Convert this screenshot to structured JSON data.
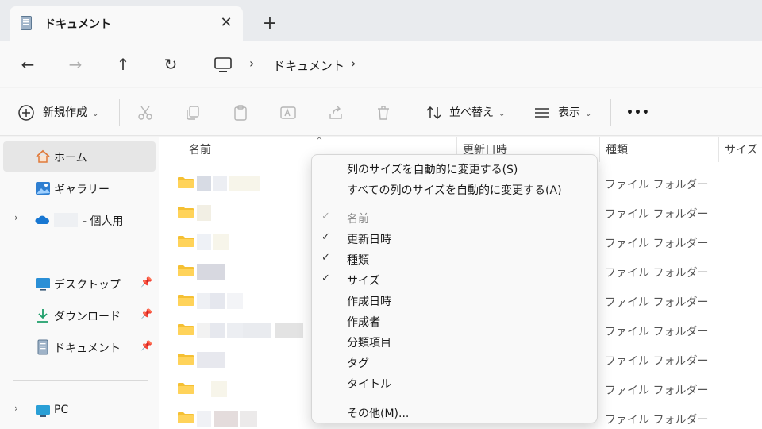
{
  "window": {
    "tab_title": "ドキュメント",
    "close_glyph": "✕",
    "new_tab_glyph": "+"
  },
  "nav": {
    "back_glyph": "←",
    "forward_glyph": "→",
    "up_glyph": "↑",
    "refresh_glyph": "↻",
    "sep_glyph": "›",
    "breadcrumb": [
      "ドキュメント"
    ]
  },
  "toolbar": {
    "new_label": "新規作成",
    "sort_label": "並べ替え",
    "view_label": "表示",
    "more_glyph": "•••",
    "chevron": "⌄"
  },
  "sidebar": {
    "home": "ホーム",
    "gallery": "ギャラリー",
    "onedrive": "- 個人用",
    "desktop": "デスクトップ",
    "downloads": "ダウンロード",
    "documents": "ドキュメント",
    "pc": "PC",
    "pin_glyph": "📌",
    "expand_glyph": "›"
  },
  "columns": {
    "name": "名前",
    "modified": "更新日時",
    "type": "種類",
    "size": "サイズ",
    "sort_glyph": "^"
  },
  "rows": [
    {
      "type": "ファイル フォルダー"
    },
    {
      "type": "ファイル フォルダー"
    },
    {
      "type": "ファイル フォルダー"
    },
    {
      "type": "ファイル フォルダー"
    },
    {
      "type": "ファイル フォルダー"
    },
    {
      "type": "ファイル フォルダー"
    },
    {
      "type": "ファイル フォルダー"
    },
    {
      "type": "ファイル フォルダー"
    },
    {
      "type": "ファイル フォルダー"
    }
  ],
  "context_menu": {
    "autosize": "列のサイズを自動的に変更する(S)",
    "autosize_all": "すべての列のサイズを自動的に変更する(A)",
    "check_glyph": "✓",
    "columns": [
      {
        "label": "名前",
        "checked": true,
        "disabled": true
      },
      {
        "label": "更新日時",
        "checked": true,
        "disabled": false
      },
      {
        "label": "種類",
        "checked": true,
        "disabled": false
      },
      {
        "label": "サイズ",
        "checked": true,
        "disabled": false
      },
      {
        "label": "作成日時",
        "checked": false,
        "disabled": false
      },
      {
        "label": "作成者",
        "checked": false,
        "disabled": false
      },
      {
        "label": "分類項目",
        "checked": false,
        "disabled": false
      },
      {
        "label": "タグ",
        "checked": false,
        "disabled": false
      },
      {
        "label": "タイトル",
        "checked": false,
        "disabled": false
      }
    ],
    "more": "その他(M)..."
  },
  "colors": {
    "folder": "#f5c033",
    "accent": "#0067c0",
    "selected": "#e6e6e6"
  }
}
